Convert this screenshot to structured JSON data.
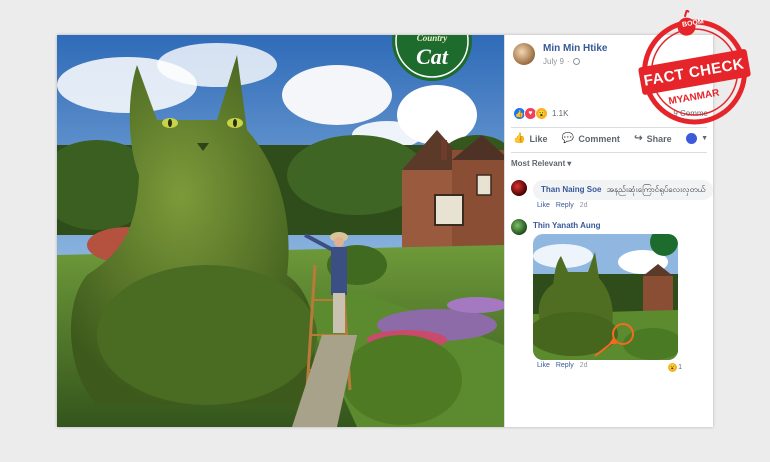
{
  "photo": {
    "logo_text": "Cat",
    "logo_arc_text": "Country"
  },
  "post": {
    "author": "Min Min Htike",
    "date": "July 9",
    "reaction_count": "1.1K",
    "comments_count": "9 Comme",
    "actions": {
      "like": "Like",
      "comment": "Comment",
      "share": "Share"
    },
    "sort_label": "Most Relevant"
  },
  "comments": [
    {
      "name": "Than Naing Soe",
      "text": "အနည်းဆုံးကြောင်ရုပ်လေးလှတယ်",
      "like": "Like",
      "reply": "Reply",
      "time": "2d"
    },
    {
      "name": "Thin Yanath Aung",
      "like": "Like",
      "reply": "Reply",
      "time": "2d",
      "reaction_count": "1"
    }
  ],
  "badge": {
    "top": "BOOM",
    "line1": "FACT CHECK",
    "line2": "MYANMAR"
  },
  "colors": {
    "link": "#385898",
    "badge_red": "#e5252a"
  }
}
